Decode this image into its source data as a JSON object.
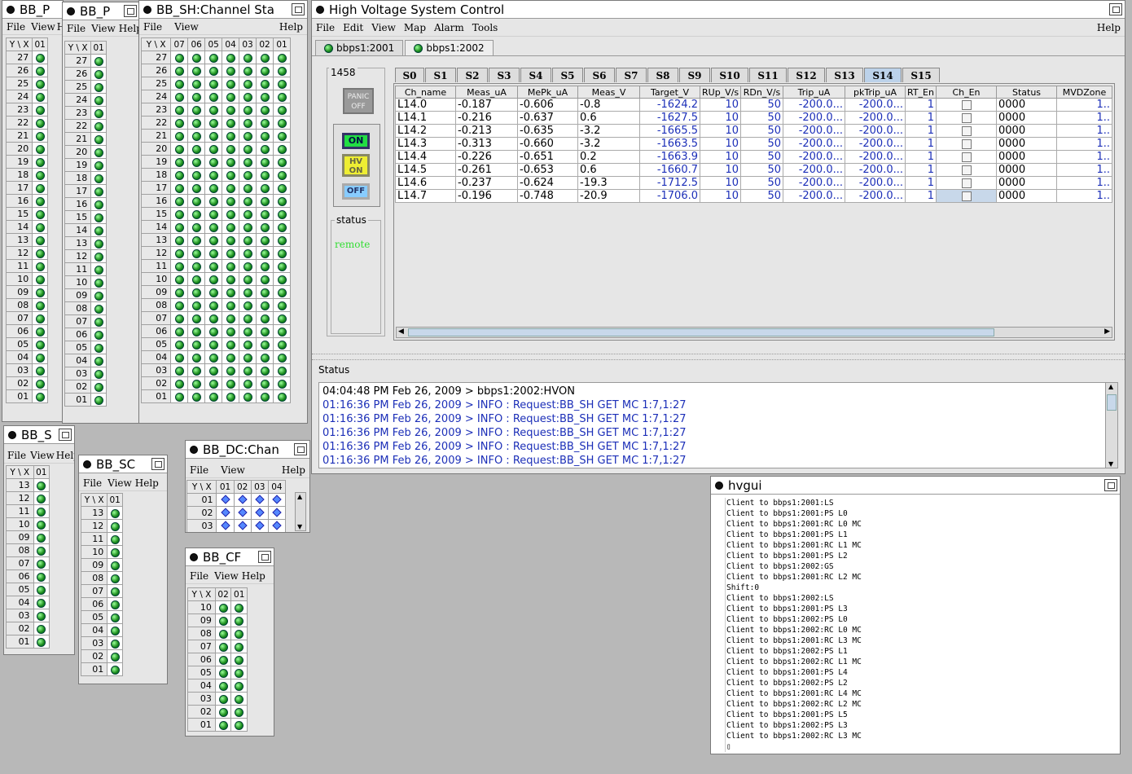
{
  "windows": {
    "bbp1": {
      "title": "BB_P",
      "menu": [
        "File",
        "View",
        "He"
      ]
    },
    "bbp2": {
      "title": "BB_P",
      "menu": [
        "File",
        "View",
        "Help"
      ]
    },
    "bbsh": {
      "title": "BB_SH:Channel Sta",
      "menu": [
        "File",
        "View"
      ],
      "help": "Help",
      "cols": [
        "07",
        "06",
        "05",
        "04",
        "03",
        "02",
        "01"
      ]
    },
    "bbs": {
      "title": "BB_S",
      "menu": [
        "File",
        "View",
        "Help"
      ]
    },
    "bbsc": {
      "title": "BB_SC",
      "menu": [
        "File",
        "View",
        "Help"
      ]
    },
    "bbdc": {
      "title": "BB_DC:Chan",
      "menu": [
        "File",
        "View"
      ],
      "help": "Help",
      "cols": [
        "01",
        "02",
        "03",
        "04"
      ],
      "rows": [
        "01",
        "02",
        "03"
      ]
    },
    "bbcf": {
      "title": "BB_CF",
      "menu": [
        "File",
        "View",
        "Help"
      ],
      "cols": [
        "02",
        "01"
      ]
    }
  },
  "corner": "Y \\ X",
  "col01": "01",
  "rows27": [
    "27",
    "26",
    "25",
    "24",
    "23",
    "22",
    "21",
    "20",
    "19",
    "18",
    "17",
    "16",
    "15",
    "14",
    "13",
    "12",
    "11",
    "10",
    "09",
    "08",
    "07",
    "06",
    "05",
    "04",
    "03",
    "02",
    "01"
  ],
  "rows13": [
    "13",
    "12",
    "11",
    "10",
    "09",
    "08",
    "07",
    "06",
    "05",
    "04",
    "03",
    "02",
    "01"
  ],
  "rows10": [
    "10",
    "09",
    "08",
    "07",
    "06",
    "05",
    "04",
    "03",
    "02",
    "01"
  ],
  "hv": {
    "title": "High Voltage System Control",
    "menu": [
      "File",
      "Edit",
      "View",
      "Map",
      "Alarm",
      "Tools"
    ],
    "help": "Help",
    "tabs": [
      "bbps1:2001",
      "bbps1:2002"
    ],
    "id": "1458",
    "panic": "PANIC OFF",
    "on": "ON",
    "hvon": "HV ON",
    "off": "OFF",
    "status_label": "status",
    "status_value": "remote",
    "slots": [
      "S0",
      "S1",
      "S2",
      "S3",
      "S4",
      "S5",
      "S6",
      "S7",
      "S8",
      "S9",
      "S10",
      "S11",
      "S12",
      "S13",
      "S14",
      "S15"
    ],
    "columns": [
      "Ch_name",
      "Meas_uA",
      "MePk_uA",
      "Meas_V",
      "Target_V",
      "RUp_V/s",
      "RDn_V/s",
      "Trip_uA",
      "pkTrip_uA",
      "RT_En",
      "Ch_En",
      "Status",
      "MVDZone"
    ],
    "rows": [
      [
        "L14.0",
        "-0.187",
        "-0.606",
        "-0.8",
        "-1624.2",
        "10",
        "50",
        "-200.0...",
        "-200.0...",
        "1",
        "",
        "0000",
        "1.."
      ],
      [
        "L14.1",
        "-0.216",
        "-0.637",
        "0.6",
        "-1627.5",
        "10",
        "50",
        "-200.0...",
        "-200.0...",
        "1",
        "",
        "0000",
        "1.."
      ],
      [
        "L14.2",
        "-0.213",
        "-0.635",
        "-3.2",
        "-1665.5",
        "10",
        "50",
        "-200.0...",
        "-200.0...",
        "1",
        "",
        "0000",
        "1.."
      ],
      [
        "L14.3",
        "-0.313",
        "-0.660",
        "-3.2",
        "-1663.5",
        "10",
        "50",
        "-200.0...",
        "-200.0...",
        "1",
        "",
        "0000",
        "1.."
      ],
      [
        "L14.4",
        "-0.226",
        "-0.651",
        "0.2",
        "-1663.9",
        "10",
        "50",
        "-200.0...",
        "-200.0...",
        "1",
        "",
        "0000",
        "1.."
      ],
      [
        "L14.5",
        "-0.261",
        "-0.653",
        "0.6",
        "-1660.7",
        "10",
        "50",
        "-200.0...",
        "-200.0...",
        "1",
        "",
        "0000",
        "1.."
      ],
      [
        "L14.6",
        "-0.237",
        "-0.624",
        "-19.3",
        "-1712.5",
        "10",
        "50",
        "-200.0...",
        "-200.0...",
        "1",
        "",
        "0000",
        "1.."
      ],
      [
        "L14.7",
        "-0.196",
        "-0.748",
        "-20.9",
        "-1706.0",
        "10",
        "50",
        "-200.0...",
        "-200.0...",
        "1",
        "",
        "0000",
        "1.."
      ]
    ],
    "status_title": "Status",
    "log": [
      "04:04:48 PM Feb 26, 2009 > bbps1:2002:HVON",
      "01:16:36 PM Feb 26, 2009 > INFO : Request:BB_SH GET MC 1:7,1:27",
      "01:16:36 PM Feb 26, 2009 > INFO : Request:BB_SH GET MC 1:7,1:27",
      "01:16:36 PM Feb 26, 2009 > INFO : Request:BB_SH GET MC 1:7,1:27",
      "01:16:36 PM Feb 26, 2009 > INFO : Request:BB_SH GET MC 1:7,1:27",
      "01:16:36 PM Feb 26, 2009 > INFO : Request:BB_SH GET MC 1:7,1:27"
    ]
  },
  "hvgui": {
    "title": "hvgui",
    "lines": [
      "Client to bbps1:2001:LS",
      "Client to bbps1:2001:PS L0",
      "Client to bbps1:2001:RC L0 MC",
      "Client to bbps1:2001:PS L1",
      "Client to bbps1:2001:RC L1 MC",
      "Client to bbps1:2001:PS L2",
      "Client to bbps1:2002:GS",
      "Client to bbps1:2001:RC L2 MC",
      "Shift:0",
      "Client to bbps1:2002:LS",
      "Client to bbps1:2001:PS L3",
      "Client to bbps1:2002:PS L0",
      "Client to bbps1:2002:RC L0 MC",
      "Client to bbps1:2001:RC L3 MC",
      "Client to bbps1:2002:PS L1",
      "Client to bbps1:2002:RC L1 MC",
      "Client to bbps1:2001:PS L4",
      "Client to bbps1:2002:PS L2",
      "Client to bbps1:2001:RC L4 MC",
      "Client to bbps1:2002:RC L2 MC",
      "Client to bbps1:2001:PS L5",
      "Client to bbps1:2002:PS L3",
      "Client to bbps1:2002:RC L3 MC"
    ]
  },
  "colors": {
    "led": "#1a8a1a",
    "blue_text": "#1c2fb8",
    "remote": "#33dd33",
    "selected_tab": "#bcd2ea"
  }
}
